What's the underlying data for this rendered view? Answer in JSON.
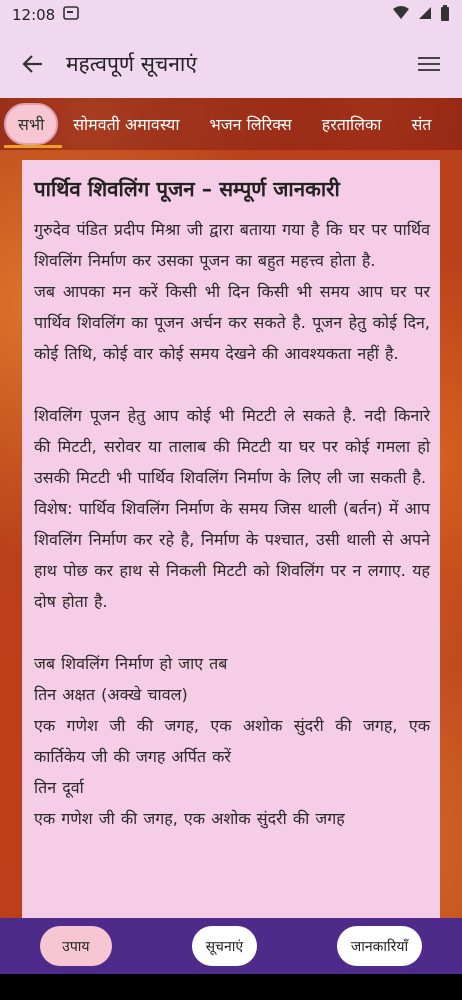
{
  "status": {
    "time": "12:08"
  },
  "appbar": {
    "title": "महत्वपूर्ण सूचनाएं",
    "back_icon": "arrow-left-icon",
    "menu_icon": "menu-icon"
  },
  "tabs": [
    "सभी",
    "सोमवती अमावस्या",
    "भजन लिरिक्स",
    "हरतालिका",
    "संत"
  ],
  "article": {
    "title": "पार्थिव शिवलिंग पूजन – सम्पूर्ण जानकारी",
    "paragraphs": [
      " गुरुदेव पंडित प्रदीप मिश्रा जी द्वारा बताया गया है कि घर पर पार्थिव शिवलिंग निर्माण कर उसका पूजन का बहुत महत्त्व होता है.",
      "जब आपका मन करें किसी भी दिन किसी भी समय आप घर पर पार्थिव शिवलिंग का पूजन अर्चन कर सकते है. पूजन हेतु कोई दिन, कोई तिथि, कोई वार कोई समय देखने की आवश्यकता नहीं है.",
      "",
      "शिवलिंग पूजन हेतु आप कोई भी मिटटी ले सकते है. नदी किनारे की मिटटी, सरोवर या तालाब की मिटटी या घर पर कोई गमला हो उसकी मिटटी भी पार्थिव शिवलिंग निर्माण के लिए ली जा सकती है.",
      "विशेष: पार्थिव शिवलिंग निर्माण के समय जिस थाली (बर्तन) में आप शिवलिंग निर्माण कर रहे है, निर्माण के पश्चात, उसी थाली से अपने हाथ पोछ कर  हाथ से निकली मिटटी को शिवलिंग पर न लगाए. यह दोष होता है.",
      "",
      "जब शिवलिंग निर्माण हो जाए तब",
      "तिन अक्षत (अक्खे चावल)",
      "एक गणेश जी की जगह, एक अशोक सुंदरी की जगह, एक कार्तिकेय जी की जगह अर्पित करें",
      "तिन दूर्वा",
      "एक गणेश जी की जगह, एक अशोक सुंदरी की जगह"
    ]
  },
  "bottom_nav": [
    "उपाय",
    "सूचनाएं",
    "जानकारियाँ"
  ]
}
